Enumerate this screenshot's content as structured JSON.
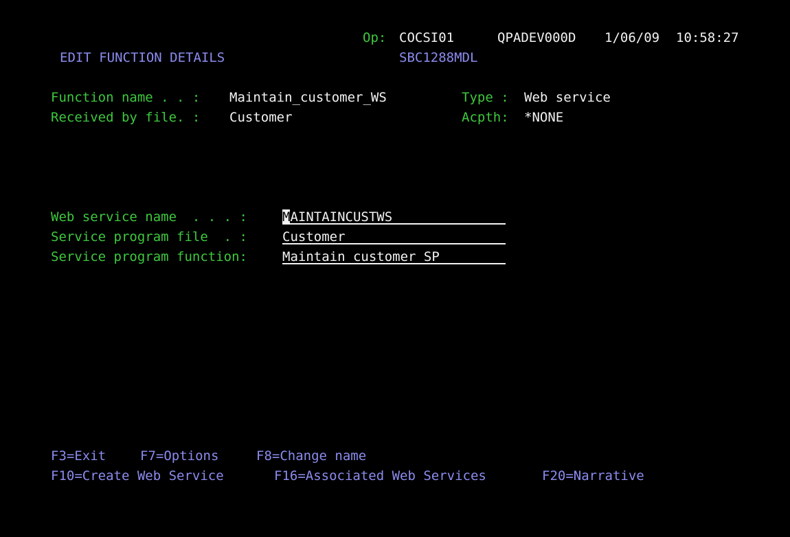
{
  "header": {
    "op_label": "Op:",
    "operator": "COCSI01",
    "device": "QPADEV000D",
    "date": "1/06/09",
    "time": "10:58:27",
    "screen_title": "EDIT FUNCTION DETAILS",
    "model": "SBC1288MDL"
  },
  "info": {
    "function_name_label": "Function name . . :",
    "function_name": "Maintain_customer_WS",
    "type_label": "Type :",
    "type": "Web service",
    "received_by_label": "Received by file. :",
    "received_by": "Customer",
    "acpth_label": "Acpth:",
    "acpth": "*NONE"
  },
  "fields": {
    "web_service_name_label": "Web service name  . . . :",
    "web_service_name_first": "M",
    "web_service_name_rest": "AINTAINCUSTWS",
    "service_program_file_label": "Service program file  . :",
    "service_program_file": "Customer",
    "service_program_function_label": "Service program function:",
    "service_program_function": "Maintain_customer_SP"
  },
  "function_keys": {
    "f3": "F3=Exit",
    "f7": "F7=Options",
    "f8": "F8=Change name",
    "f10": "F10=Create Web Service",
    "f16": "F16=Associated Web Services",
    "f20": "F20=Narrative"
  },
  "colors": {
    "background": "#000000",
    "label_green": "#3ec83e",
    "value_white": "#f2f2f2",
    "title_blue": "#8c8cf0"
  }
}
